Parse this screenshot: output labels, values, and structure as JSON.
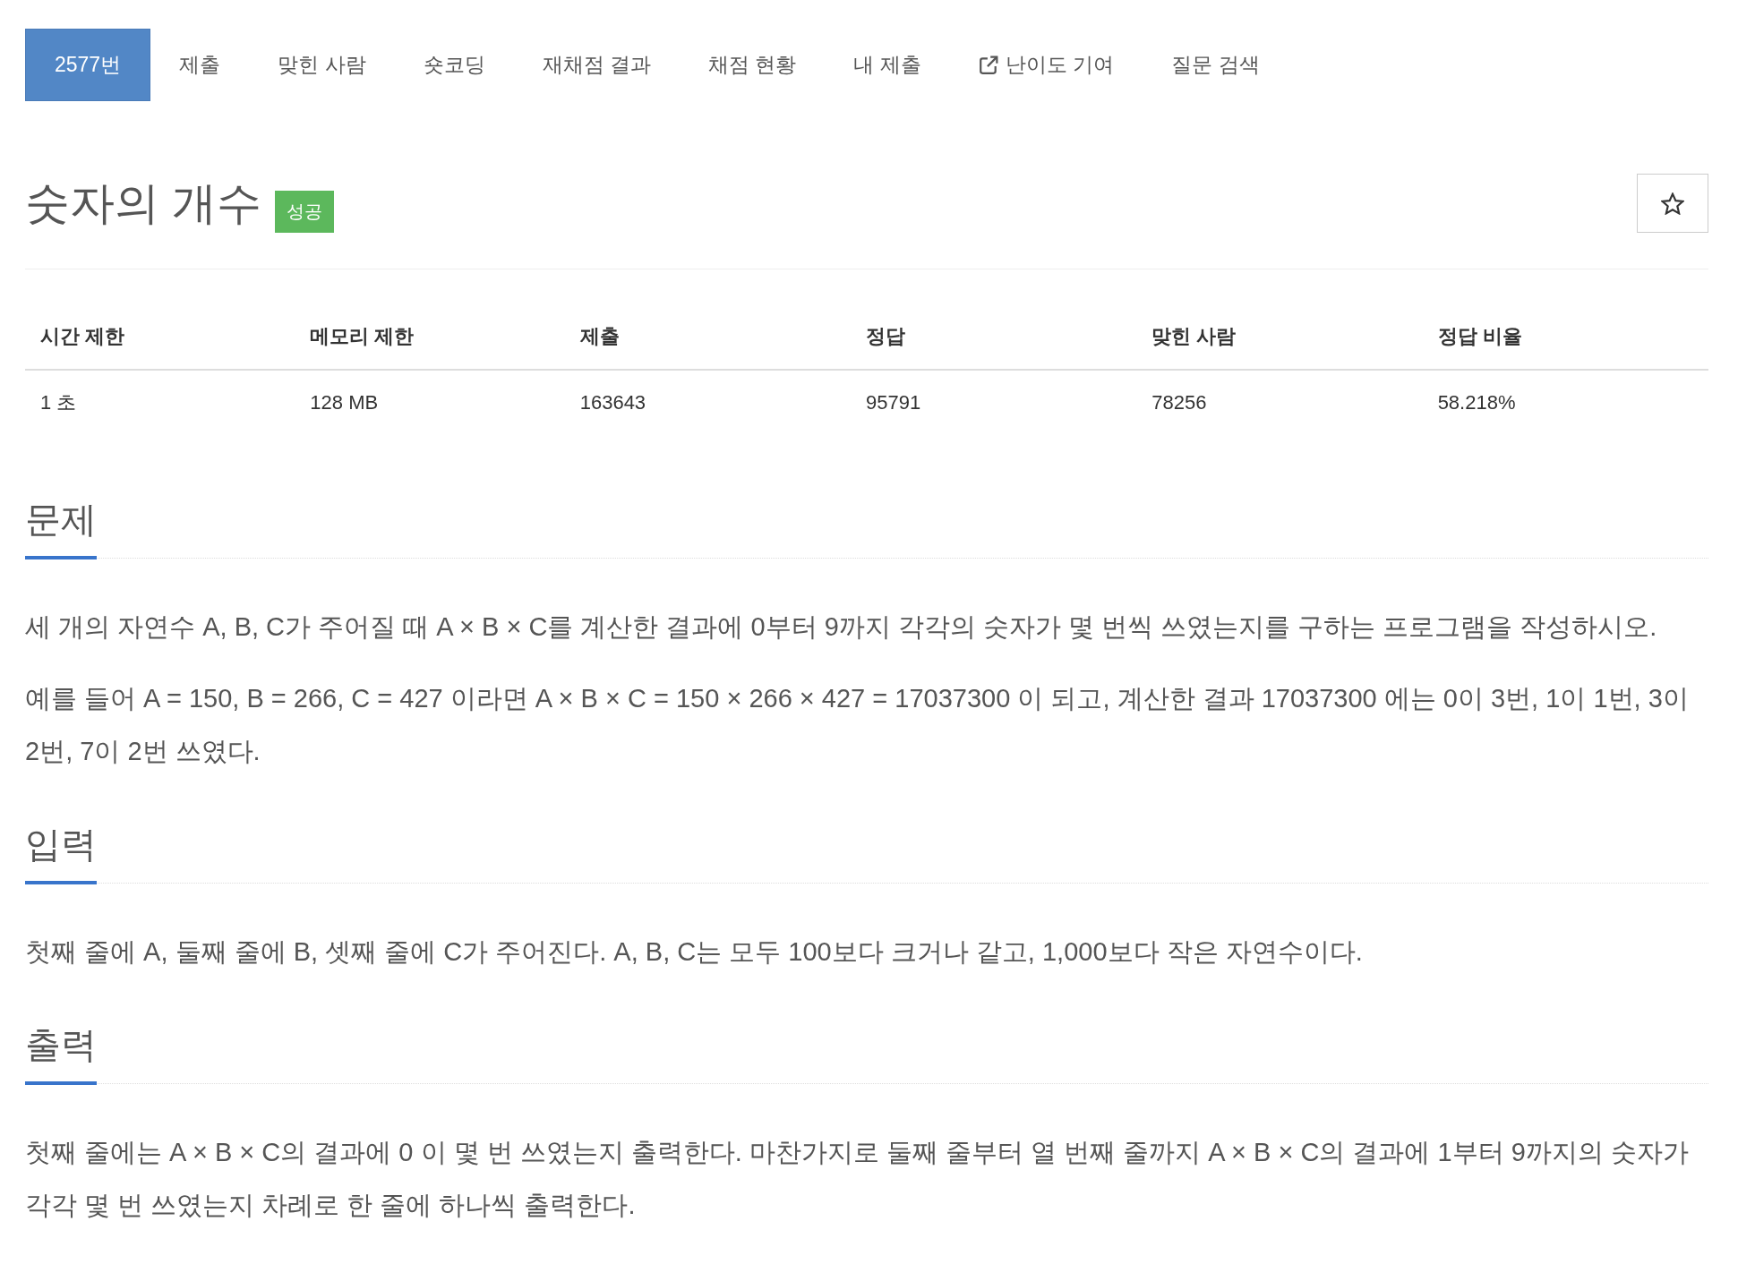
{
  "tabs": [
    {
      "label": "2577번",
      "selected": true,
      "external": false
    },
    {
      "label": "제출",
      "selected": false,
      "external": false
    },
    {
      "label": "맞힌 사람",
      "selected": false,
      "external": false
    },
    {
      "label": "숏코딩",
      "selected": false,
      "external": false
    },
    {
      "label": "재채점 결과",
      "selected": false,
      "external": false
    },
    {
      "label": "채점 현황",
      "selected": false,
      "external": false
    },
    {
      "label": "내 제출",
      "selected": false,
      "external": false
    },
    {
      "label": "난이도 기여",
      "selected": false,
      "external": true
    },
    {
      "label": "질문 검색",
      "selected": false,
      "external": false
    }
  ],
  "problem": {
    "title": "숫자의 개수",
    "badge": "성공",
    "starred": false
  },
  "info_table": {
    "columns": [
      "시간 제한",
      "메모리 제한",
      "제출",
      "정답",
      "맞힌 사람",
      "정답 비율"
    ],
    "rows": [
      [
        "1 초",
        "128 MB",
        "163643",
        "95791",
        "78256",
        "58.218%"
      ]
    ]
  },
  "sections": [
    {
      "heading": "문제",
      "paragraphs": [
        "세 개의 자연수 A, B, C가 주어질 때 A × B × C를 계산한 결과에 0부터 9까지 각각의 숫자가 몇 번씩 쓰였는지를 구하는 프로그램을 작성하시오.",
        "예를 들어 A = 150, B = 266, C = 427 이라면 A × B × C = 150 × 266 × 427 = 17037300 이 되고, 계산한 결과 17037300 에는 0이 3번, 1이 1번, 3이 2번, 7이 2번 쓰였다."
      ]
    },
    {
      "heading": "입력",
      "paragraphs": [
        "첫째 줄에 A, 둘째 줄에 B, 셋째 줄에 C가 주어진다. A, B, C는 모두 100보다 크거나 같고, 1,000보다 작은 자연수이다."
      ]
    },
    {
      "heading": "출력",
      "paragraphs": [
        "첫째 줄에는 A × B × C의 결과에 0 이 몇 번 쓰였는지 출력한다. 마찬가지로 둘째 줄부터 열 번째 줄까지 A × B × C의 결과에 1부터 9까지의 숫자가 각각 몇 번 쓰였는지 차례로 한 줄에 하나씩 출력한다."
      ]
    }
  ]
}
